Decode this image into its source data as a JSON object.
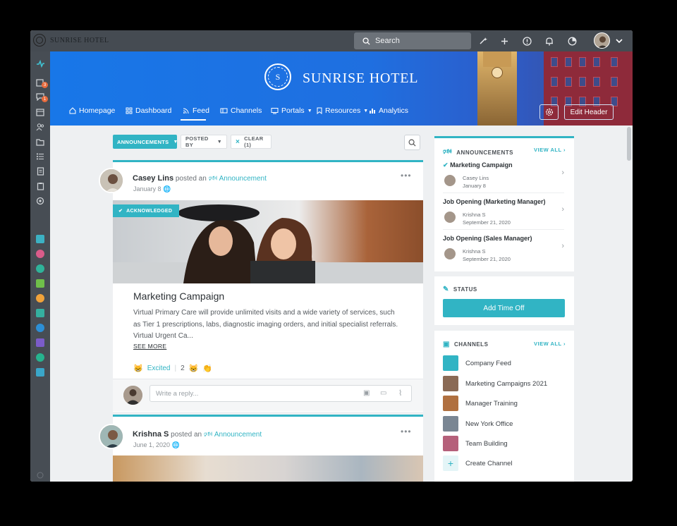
{
  "app": {
    "brand": "SUNRISE HOTEL"
  },
  "topbar": {
    "search_label": "Search",
    "icons": [
      "search-icon",
      "magic-wand-icon",
      "plus-icon",
      "help-icon",
      "bell-icon",
      "pie-chart-icon",
      "chevron-down-icon"
    ]
  },
  "sidebar": {
    "nav_icons": [
      "activity-icon",
      "tasks-icon",
      "chat-icon",
      "calendar-icon",
      "people-icon",
      "folder-icon",
      "checklist-icon",
      "document-icon",
      "clipboard-icon",
      "settings-icon"
    ],
    "badges": [
      "3",
      "1"
    ],
    "apps": [
      {
        "name": "app-1-icon",
        "color": "#3cb1c3"
      },
      {
        "name": "app-2-icon",
        "color": "#d95c8a"
      },
      {
        "name": "app-3-icon",
        "color": "#2fb39a"
      },
      {
        "name": "app-4-icon",
        "color": "#6fbf4a"
      },
      {
        "name": "app-5-icon",
        "color": "#f0a23a"
      },
      {
        "name": "app-6-icon",
        "color": "#35b0a0"
      },
      {
        "name": "app-7-icon",
        "color": "#2c8fd6"
      },
      {
        "name": "app-8-icon",
        "color": "#7b5cc9"
      },
      {
        "name": "app-9-icon",
        "color": "#26b38e"
      },
      {
        "name": "app-10-icon",
        "color": "#3aa6c9"
      }
    ]
  },
  "banner": {
    "title": "SUNRISE HOTEL",
    "logo_letter": "S",
    "nav": [
      {
        "label": "Homepage",
        "icon": "home-icon"
      },
      {
        "label": "Dashboard",
        "icon": "grid-icon"
      },
      {
        "label": "Feed",
        "icon": "rss-icon",
        "active": true
      },
      {
        "label": "Channels",
        "icon": "channels-icon"
      },
      {
        "label": "Portals",
        "icon": "portal-icon"
      },
      {
        "label": "Resources",
        "icon": "bookmark-icon"
      },
      {
        "label": "Analytics",
        "icon": "bar-chart-icon"
      }
    ],
    "edit_label": "Edit Header"
  },
  "filters": {
    "announcements": "ANNOUNCEMENTS",
    "posted_by": "POSTED BY",
    "clear": "CLEAR (1)"
  },
  "posts": [
    {
      "author": "Casey Lins",
      "action": "posted an",
      "type": "Announcement",
      "date": "January 8",
      "badge": "ACKNOWLEDGED",
      "title": "Marketing Campaign",
      "body": "Virtual Primary Care will provide unlimited visits and a wide variety of services, such as Tier 1 prescriptions, labs, diagnostic imaging orders, and initial specialist referrals. Virtual Urgent Ca...",
      "see_more": "SEE MORE",
      "reaction_label": "Excited",
      "reaction_count": "2",
      "reply_placeholder": "Write a reply..."
    },
    {
      "author": "Krishna S",
      "action": "posted an",
      "type": "Announcement",
      "date": "June 1, 2020"
    }
  ],
  "announcements": {
    "heading": "ANNOUNCEMENTS",
    "view_all": "VIEW ALL",
    "items": [
      {
        "title": "Marketing Campaign",
        "author": "Casey Lins",
        "date": "January 8"
      },
      {
        "title": "Job Opening (Marketing Manager)",
        "author": "Krishna S",
        "date": "September 21, 2020"
      },
      {
        "title": "Job Opening (Sales Manager)",
        "author": "Krishna S",
        "date": "September 21, 2020"
      }
    ]
  },
  "status": {
    "heading": "STATUS",
    "button": "Add Time Off"
  },
  "channels": {
    "heading": "CHANNELS",
    "view_all": "VIEW ALL",
    "items": [
      {
        "label": "Company Feed",
        "color": "#31b4c4"
      },
      {
        "label": "Marketing Campaigns 2021",
        "color": "#8a6a55"
      },
      {
        "label": "Manager Training",
        "color": "#b07040"
      },
      {
        "label": "New York Office",
        "color": "#7a8693"
      },
      {
        "label": "Team Building",
        "color": "#b5607a"
      }
    ],
    "create": "Create Channel"
  }
}
